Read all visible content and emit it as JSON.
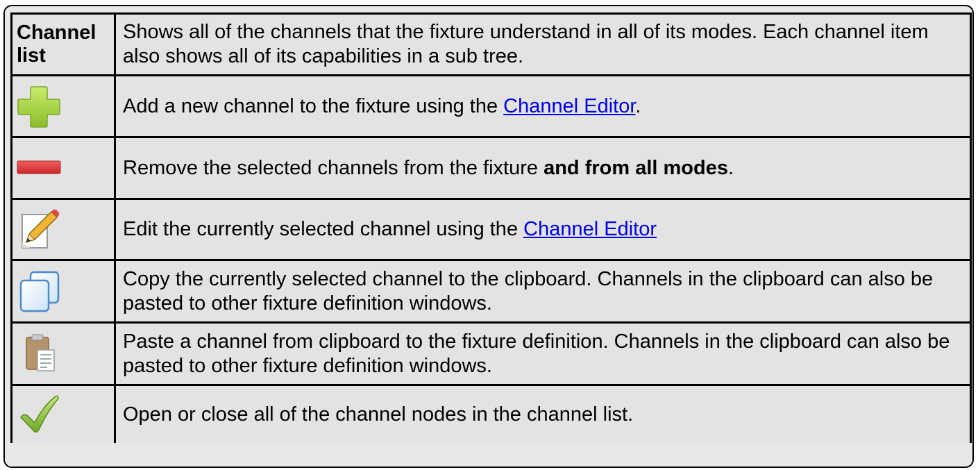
{
  "table": {
    "header": {
      "label": "Channel list",
      "text": "Shows all of the channels that the fixture understand in all of its modes. Each channel item also shows all of its capabilities in a sub tree."
    },
    "rows": [
      {
        "icon": "add-icon",
        "before": "Add a new channel to the fixture using the ",
        "link": "Channel Editor",
        "after": "."
      },
      {
        "icon": "remove-icon",
        "before": "Remove the selected channels from the fixture ",
        "bold": "and from all modes",
        "after": "."
      },
      {
        "icon": "edit-icon",
        "before": "Edit the currently selected channel using the ",
        "link": "Channel Editor",
        "after": ""
      },
      {
        "icon": "copy-icon",
        "text": "Copy the currently selected channel to the clipboard. Channels in the clipboard can also be pasted to other fixture definition windows."
      },
      {
        "icon": "paste-icon",
        "text": "Paste a channel from clipboard to the fixture definition. Channels in the clipboard can also be pasted to other fixture definition windows."
      },
      {
        "icon": "checkmark-icon",
        "text": "Open or close all of the channel nodes in the channel list."
      }
    ]
  },
  "colors": {
    "cell_background": "#e3e3e3",
    "link": "#0000ee",
    "add_icon_green": "#9ccc3a",
    "remove_icon_red": "#d83a3a"
  }
}
